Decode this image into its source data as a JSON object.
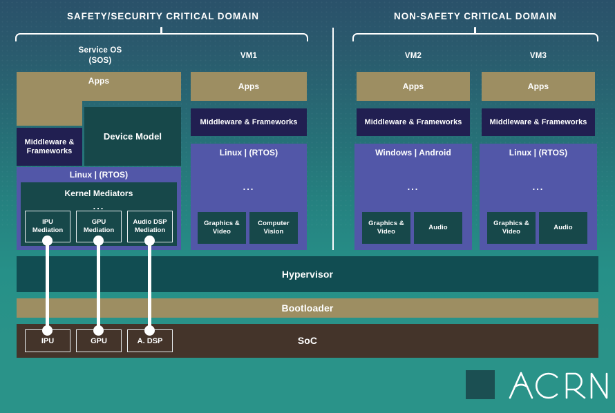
{
  "domains": [
    {
      "id": "safety",
      "title": "SAFETY/SECURITY CRITICAL DOMAIN"
    },
    {
      "id": "non-safety",
      "title": "NON-SAFETY CRITICAL DOMAIN"
    }
  ],
  "columns": {
    "sos": {
      "label_line1": "Service OS",
      "label_line2": "(SOS)",
      "apps": "Apps",
      "middleware": "Middleware &\nFrameworks",
      "middleware_line1": "Middleware &",
      "middleware_line2": "Frameworks",
      "device_model": "Device Model",
      "os": "Linux | (RTOS)",
      "kernel_mediators": "Kernel Mediators",
      "dots": "...",
      "mediations": [
        {
          "line1": "IPU",
          "line2": "Mediation"
        },
        {
          "line1": "GPU",
          "line2": "Mediation"
        },
        {
          "line1": "Audio DSP",
          "line2": "Mediation"
        }
      ]
    },
    "vm1": {
      "label": "VM1",
      "apps": "Apps",
      "middleware": "Middleware & Frameworks",
      "os": "Linux | (RTOS)",
      "dots": "...",
      "services": [
        {
          "line1": "Graphics &",
          "line2": "Video"
        },
        {
          "line1": "Computer",
          "line2": "Vision"
        }
      ]
    },
    "vm2": {
      "label": "VM2",
      "apps": "Apps",
      "middleware": "Middleware & Frameworks",
      "os": "Windows | Android",
      "dots": "...",
      "services": [
        {
          "line1": "Graphics &",
          "line2": "Video"
        },
        {
          "line1": "Audio",
          "line2": ""
        }
      ]
    },
    "vm3": {
      "label": "VM3",
      "apps": "Apps",
      "middleware": "Middleware & Frameworks",
      "os": "Linux | (RTOS)",
      "dots": "...",
      "services": [
        {
          "line1": "Graphics &",
          "line2": "Video"
        },
        {
          "line1": "Audio",
          "line2": ""
        }
      ]
    }
  },
  "bars": {
    "hypervisor": "Hypervisor",
    "bootloader": "Bootloader",
    "soc": "SoC"
  },
  "soc_chips": [
    {
      "label": "IPU"
    },
    {
      "label": "GPU"
    },
    {
      "label": "A. DSP"
    }
  ],
  "logo": {
    "text": "ACRN"
  },
  "colors": {
    "background_top": "#2a516a",
    "background_bottom": "#2a9389",
    "apps_tan": "#9d8e62",
    "middleware_navy": "#211f51",
    "os_purple": "#5257a8",
    "service_teal": "#17484a",
    "hypervisor_teal": "#114d52",
    "bootloader_tan": "#9d8e62",
    "soc_brown": "#44342a",
    "accent_white": "#ffffff",
    "logo_mark": "#1b4f52"
  }
}
